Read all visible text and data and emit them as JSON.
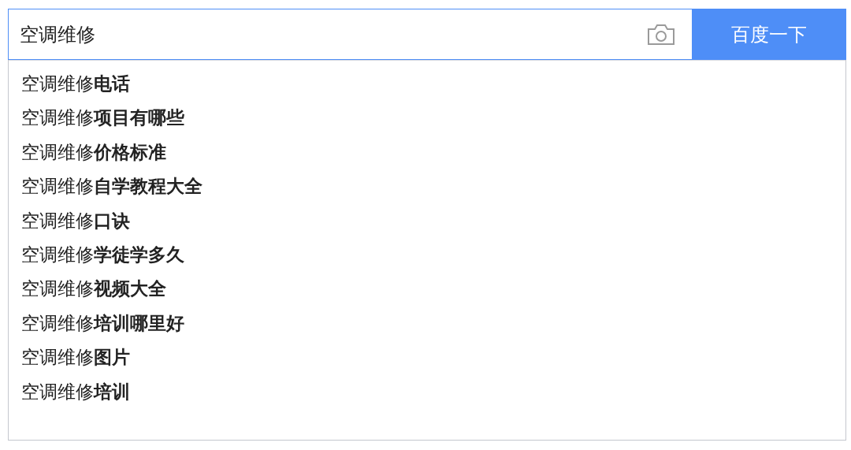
{
  "search": {
    "value": "空调维修",
    "button": "百度一下"
  },
  "suggestions": [
    {
      "text": "空调维修**电话**"
    },
    {
      "text": "空调维修**项目有哪些**"
    },
    {
      "text": "空调维修**价格标准**"
    },
    {
      "text": "空调维修**自学教程大全**"
    },
    {
      "text": "空调维修**口诀**"
    },
    {
      "text": "空调维修**学徒学多久**"
    },
    {
      "text": "空调维修**视频大全**"
    },
    {
      "text": "空调维修**培训哪里好**"
    },
    {
      "text": "空调维修**图片**"
    },
    {
      "text": "空调维修**培训**"
    }
  ]
}
